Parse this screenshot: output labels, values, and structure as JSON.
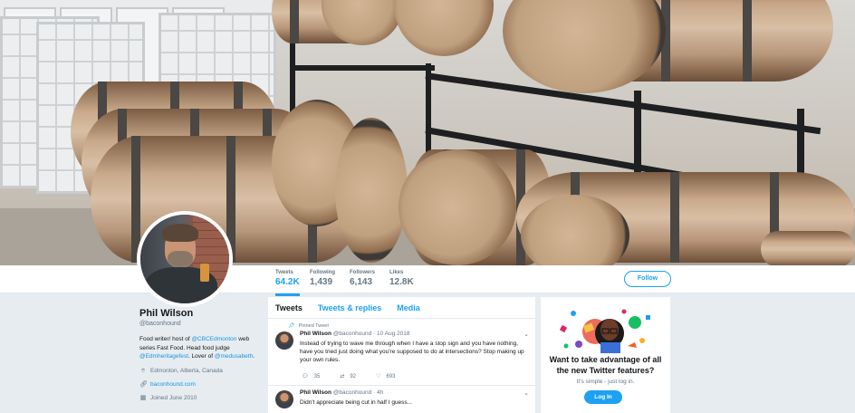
{
  "colors": {
    "accent": "#1da1f2",
    "link": "#1b95e0",
    "muted": "#657786",
    "page_bg": "#e6ecf0"
  },
  "stats": [
    {
      "label": "Tweets",
      "value": "64.2K"
    },
    {
      "label": "Following",
      "value": "1,439"
    },
    {
      "label": "Followers",
      "value": "6,143"
    },
    {
      "label": "Likes",
      "value": "12.8K"
    }
  ],
  "follow_label": "Follow",
  "profile": {
    "name": "Phil Wilson",
    "handle": "@baconhound",
    "bio": {
      "t1": "Food writer/ host of ",
      "link1": "@CBCEdmonton",
      "t2": " web series Fast Food. Head food judge ",
      "link2": "@Edmheritagefest",
      "t3": ". Lover of ",
      "link3": "@medusabeth",
      "t4": "."
    },
    "location": "Edmonton, Alberta, Canada",
    "website": "baconhound.com",
    "joined": "Joined June 2010"
  },
  "tabs": [
    "Tweets",
    "Tweets & replies",
    "Media"
  ],
  "tweets": [
    {
      "pinned_label": "Pinned Tweet",
      "name": "Phil Wilson",
      "handle_time": "@baconhound · 10 Aug 2018",
      "text": "Instead of trying to wave me through when I have a stop sign and you have nothing, have you tried just doing what you're supposed to do at intersections? Stop making up your own rules.",
      "replies": "35",
      "retweets": "92",
      "likes": "693"
    },
    {
      "name": "Phil Wilson",
      "handle_time": "@baconhound · 4h",
      "text": "Didn't appreciate being cut in half I guess..."
    }
  ],
  "card": {
    "title": "Want to take advantage of all the new Twitter features?",
    "subtitle": "It's simple - just log in.",
    "button": "Log In"
  },
  "icons": {
    "location": "location-pin-icon",
    "link": "link-icon",
    "calendar": "calendar-icon",
    "pin": "pin-icon",
    "reply": "reply-icon",
    "retweet": "retweet-icon",
    "like": "heart-icon",
    "chevron": "chevron-down-icon"
  }
}
